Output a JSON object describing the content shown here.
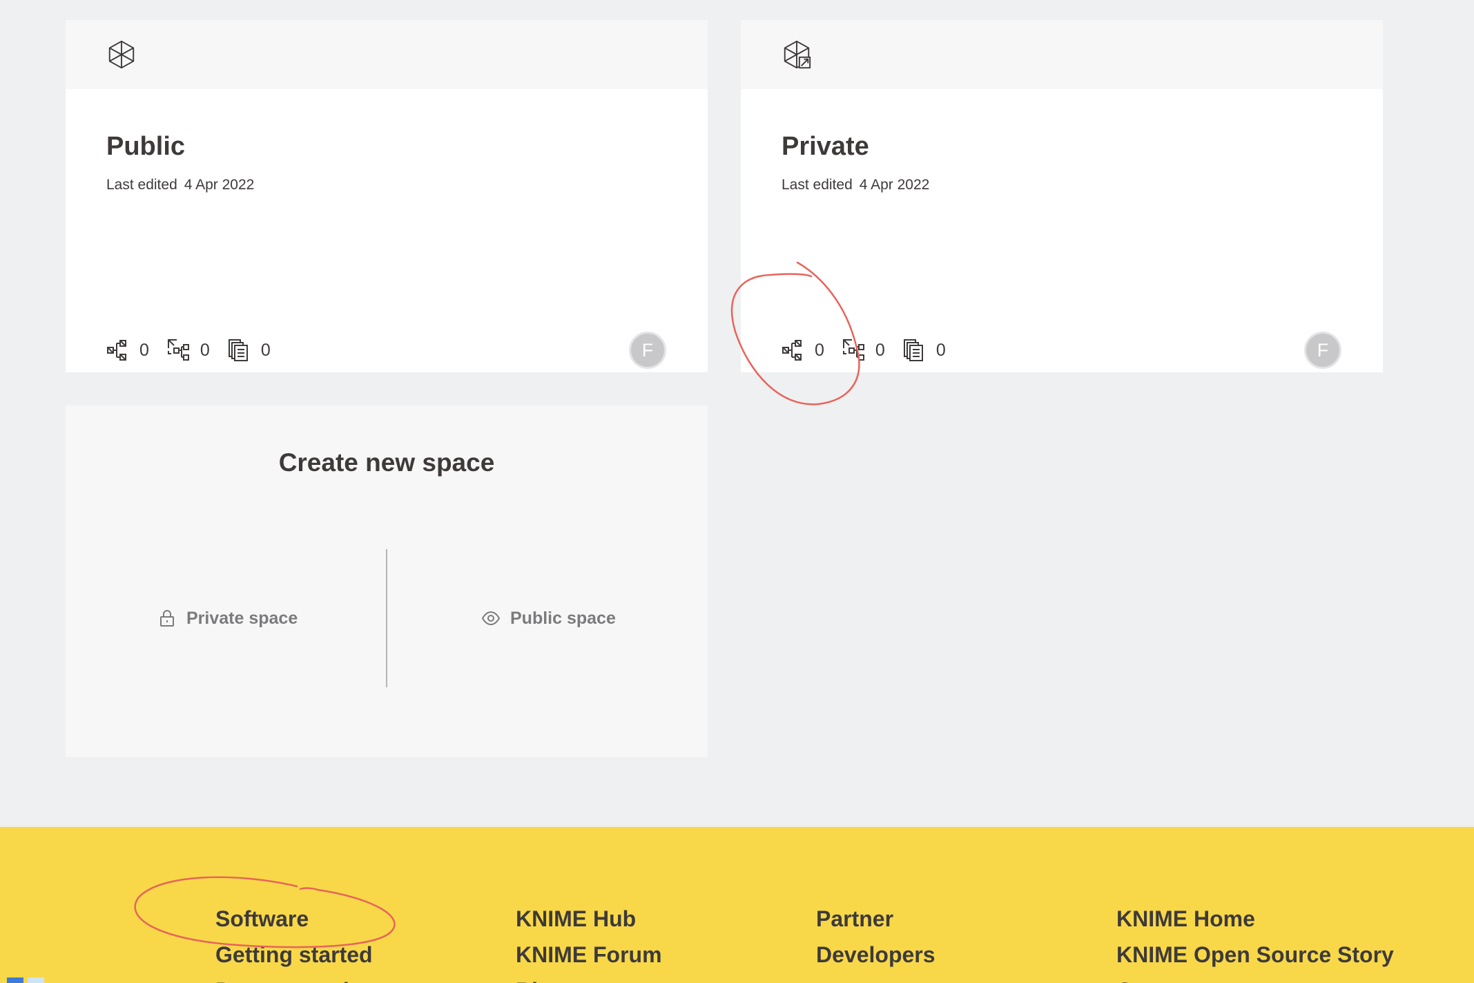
{
  "spaces": [
    {
      "title": "Public",
      "last_edited_label": "Last edited",
      "last_edited_date": "4 Apr 2022",
      "icon": "public-space-cube-icon",
      "stats": [
        {
          "icon": "workflow-icon",
          "count": "0"
        },
        {
          "icon": "component-icon",
          "count": "0"
        },
        {
          "icon": "data-file-icon",
          "count": "0"
        }
      ],
      "owner_initial": "F"
    },
    {
      "title": "Private",
      "last_edited_label": "Last edited",
      "last_edited_date": "4 Apr 2022",
      "icon": "private-space-cube-icon",
      "stats": [
        {
          "icon": "workflow-icon",
          "count": "0"
        },
        {
          "icon": "component-icon",
          "count": "0"
        },
        {
          "icon": "data-file-icon",
          "count": "0"
        }
      ],
      "owner_initial": "F"
    }
  ],
  "create_space": {
    "title": "Create new space",
    "options": [
      {
        "label": "Private space",
        "icon": "lock-icon"
      },
      {
        "label": "Public space",
        "icon": "eye-icon"
      }
    ]
  },
  "footer": {
    "columns": [
      {
        "links": [
          "Software",
          "Getting started",
          "Documentation"
        ]
      },
      {
        "links": [
          "KNIME Hub",
          "KNIME Forum",
          "Blog"
        ]
      },
      {
        "links": [
          "Partner",
          "Developers"
        ]
      },
      {
        "links": [
          "KNIME Home",
          "KNIME Open Source Story",
          "Careers"
        ]
      }
    ],
    "background_color": "#f8d849"
  },
  "annotation_color": "#e8635a"
}
